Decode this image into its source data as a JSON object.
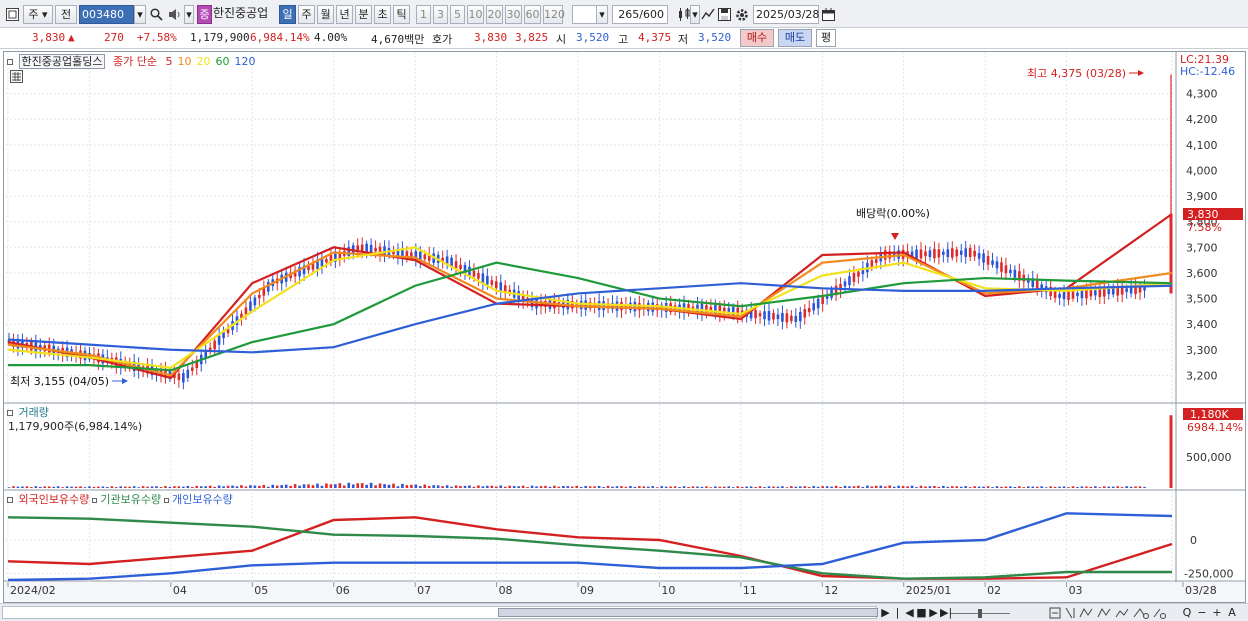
{
  "toolbar": {
    "market": "주",
    "range": "전",
    "code": "003480",
    "badge": "증",
    "name": "한진중공업",
    "periods": [
      "일",
      "주",
      "월",
      "년",
      "분",
      "초",
      "틱"
    ],
    "active_period": "일",
    "intervals": [
      "1",
      "3",
      "5",
      "10",
      "20",
      "30",
      "60",
      "120"
    ],
    "count": "265",
    "count_total": "/600",
    "date": "2025/03/28"
  },
  "quote": {
    "price": "3,830",
    "arrow": "▲",
    "change": "270",
    "pct": "+7.58%",
    "volume": "1,179,900",
    "vol_pct": "6,984.14%",
    "turnover": "4.00%",
    "amount": "4,670백만",
    "hoga_label": "호가",
    "ask": "3,830",
    "bid": "3,825",
    "open_label": "시",
    "open": "3,520",
    "high_label": "고",
    "high": "4,375",
    "low_label": "저",
    "low": "3,520",
    "buy": "매수",
    "sell": "매도",
    "avg": "평"
  },
  "price_panel": {
    "stock_tag": "한진중공업홀딩스",
    "ma_label": "종가 단순",
    "ma_periods": [
      "5",
      "10",
      "20",
      "60",
      "120"
    ],
    "ma_colors": [
      "#d42020",
      "#f08a1c",
      "#f2e21c",
      "#1f9a3a",
      "#2f5fd6"
    ],
    "lc": "LC:21.39",
    "hc": "HC:-12.46",
    "current_tag": "3,830",
    "current_pct": "7.58%",
    "high_note": "최고 4,375 (03/28)",
    "low_note": "최저 3,155 (04/05)",
    "dividend_note": "배당락(0.00%)"
  },
  "volume_panel": {
    "title": "거래량",
    "value": "1,179,900주(6,984.14%)",
    "current_tag": "1,180K",
    "current_pct": "6984.14%"
  },
  "holding_panel": {
    "titles": [
      "외국인보유수량",
      "기관보유수량",
      "개인보유수량"
    ],
    "colors": [
      "#d42020",
      "#2f8a4a",
      "#2f5fd6"
    ]
  },
  "x_axis": {
    "labels": [
      "2024/02",
      "04",
      "05",
      "06",
      "07",
      "08",
      "09",
      "10",
      "11",
      "12",
      "2025/01",
      "02",
      "03",
      "03/28"
    ]
  },
  "chart_data": [
    {
      "type": "line",
      "title": "",
      "xlabel": "",
      "ylabel": "",
      "ylim": [
        3100,
        4400
      ],
      "yticks": [
        3200,
        3300,
        3400,
        3500,
        3600,
        3700,
        3800,
        3900,
        4000,
        4100,
        4200,
        4300
      ],
      "ytick_labels": [
        "3,200",
        "3,300",
        "3,400",
        "3,500",
        "3,600",
        "3,700",
        "3,800",
        "3,900",
        "4,000",
        "4,100",
        "4,200",
        "4,300"
      ],
      "x": [
        "2024/02",
        "03",
        "04",
        "05",
        "06",
        "07",
        "08",
        "09",
        "10",
        "11",
        "12",
        "2025/01",
        "02",
        "03",
        "03/28"
      ],
      "series": [
        {
          "name": "5",
          "values": [
            3330,
            3270,
            3190,
            3560,
            3700,
            3650,
            3480,
            3470,
            3460,
            3420,
            3670,
            3680,
            3510,
            3540,
            3830
          ]
        },
        {
          "name": "10",
          "values": [
            3320,
            3280,
            3200,
            3520,
            3680,
            3660,
            3500,
            3470,
            3460,
            3430,
            3640,
            3670,
            3520,
            3540,
            3600
          ]
        },
        {
          "name": "20",
          "values": [
            3300,
            3270,
            3230,
            3450,
            3650,
            3700,
            3530,
            3480,
            3470,
            3440,
            3590,
            3640,
            3540,
            3530,
            3560
          ]
        },
        {
          "name": "60",
          "values": [
            3240,
            3240,
            3220,
            3330,
            3400,
            3550,
            3640,
            3580,
            3500,
            3470,
            3510,
            3560,
            3580,
            3570,
            3560
          ]
        },
        {
          "name": "120",
          "values": [
            3340,
            3320,
            3300,
            3290,
            3310,
            3400,
            3480,
            3520,
            3540,
            3560,
            3540,
            3530,
            3530,
            3540,
            3550
          ]
        }
      ]
    },
    {
      "type": "bar",
      "title": "",
      "ylim": [
        0,
        1200000
      ],
      "yticks": [
        500000
      ],
      "ytick_labels": [
        "500,000"
      ],
      "categories": [
        "2024/02",
        "03",
        "04",
        "05",
        "06",
        "07",
        "08",
        "09",
        "10",
        "11",
        "12",
        "2025/01",
        "02",
        "03",
        "03/28"
      ],
      "values": [
        20000,
        18000,
        22000,
        35000,
        60000,
        30000,
        25000,
        22000,
        18000,
        20000,
        28000,
        20000,
        18000,
        20000,
        1179900
      ]
    },
    {
      "type": "line",
      "title": "",
      "ylim": [
        -300000,
        300000
      ],
      "yticks": [
        0,
        -250000
      ],
      "ytick_labels": [
        "0",
        "-250,000"
      ],
      "x": [
        "2024/02",
        "03",
        "04",
        "05",
        "06",
        "07",
        "08",
        "09",
        "10",
        "11",
        "12",
        "2025/01",
        "02",
        "03",
        "03/28"
      ],
      "series": [
        {
          "name": "외국인보유수량",
          "values": [
            -160000,
            -180000,
            -130000,
            -80000,
            150000,
            170000,
            80000,
            20000,
            0,
            -120000,
            -270000,
            -290000,
            -290000,
            -280000,
            -30000
          ]
        },
        {
          "name": "기관보유수량",
          "values": [
            170000,
            160000,
            130000,
            100000,
            40000,
            30000,
            10000,
            -40000,
            -80000,
            -130000,
            -250000,
            -290000,
            -280000,
            -240000,
            -240000
          ]
        },
        {
          "name": "개인보유수량",
          "values": [
            -300000,
            -290000,
            -250000,
            -190000,
            -170000,
            -170000,
            -170000,
            -170000,
            -210000,
            -210000,
            -180000,
            -20000,
            0,
            200000,
            180000
          ]
        }
      ]
    }
  ],
  "bottom": {
    "buttons": [
      "▶",
      "|◀",
      "◀",
      "■",
      "▶",
      "▶|"
    ],
    "tools": [
      "Q",
      "−",
      "+",
      "A"
    ]
  }
}
